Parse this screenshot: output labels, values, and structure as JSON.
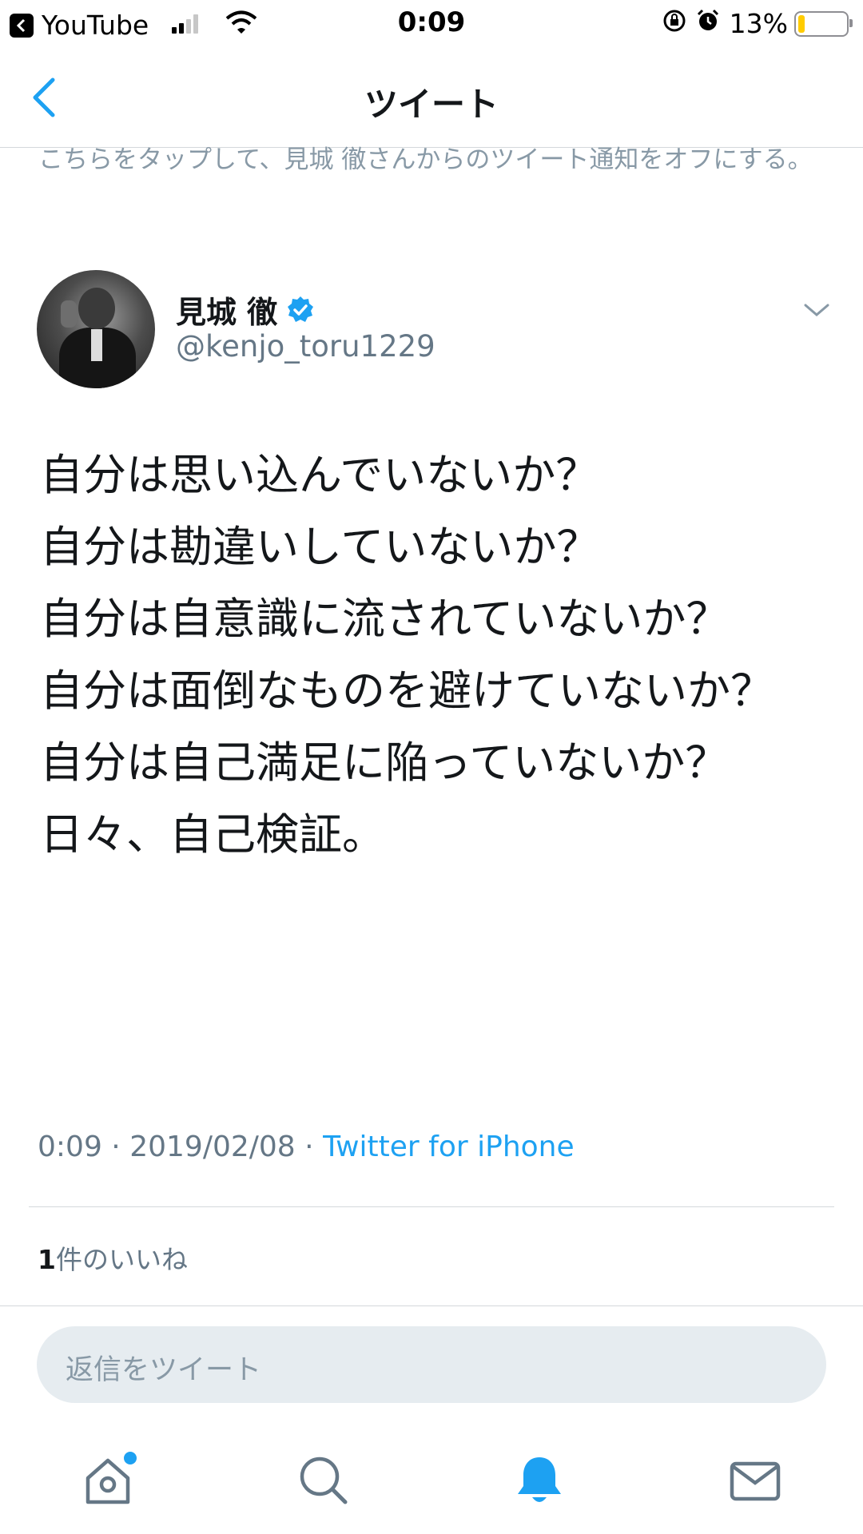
{
  "status_bar": {
    "back_app": "YouTube",
    "time": "0:09",
    "battery_percent": "13%",
    "battery_level": 0.13,
    "icons": [
      "back-app-icon",
      "signal-icon",
      "wifi-icon",
      "rotation-lock-icon",
      "alarm-icon",
      "battery-icon"
    ]
  },
  "nav": {
    "title": "ツイート",
    "back_icon": "chevron-left-icon"
  },
  "notification": {
    "text": "こちらをタップして、見城 徹さんからのツイート通知をオフにする。"
  },
  "tweet": {
    "display_name": "見城 徹",
    "verified": true,
    "handle": "@kenjo_toru1229",
    "body": "自分は思い込んでいないか？\n自分は勘違いしていないか？\n自分は自意識に流されていないか？\n自分は面倒なものを避けていないか？\n自分は自己満足に陥っていないか？\n日々、自己検証。",
    "time": "0:09",
    "date": "2019/02/08",
    "separator": "·",
    "source": "Twitter for iPhone",
    "likes_count": "1",
    "likes_label": "件のいいね"
  },
  "reply": {
    "placeholder": "返信をツイート"
  },
  "tab_bar": {
    "tabs": [
      "home-icon",
      "search-icon",
      "notifications-icon",
      "messages-icon"
    ],
    "active": "notifications-icon"
  },
  "colors": {
    "accent": "#1da1f2",
    "secondary_text": "#657786",
    "divider": "#d4d8db",
    "reply_background": "#e6ecf0"
  }
}
